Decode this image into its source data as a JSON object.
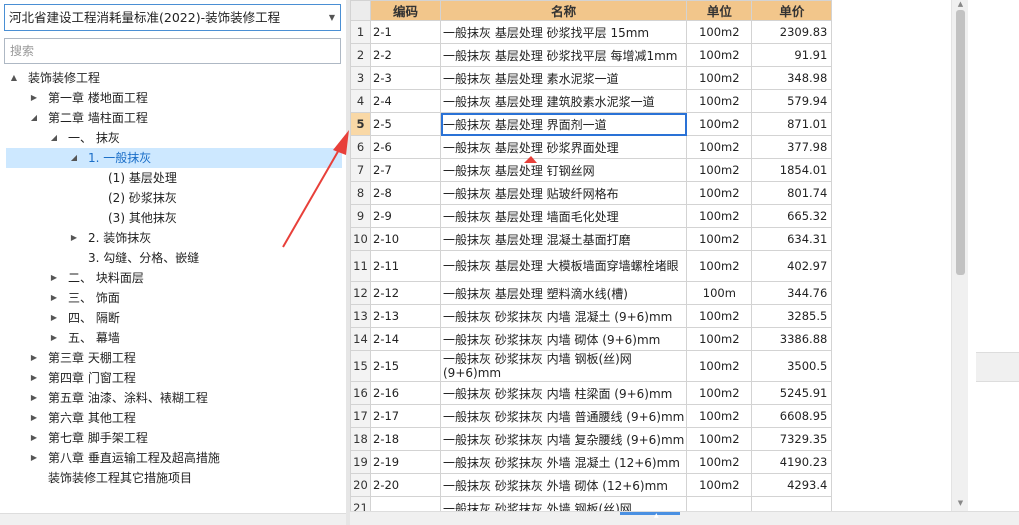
{
  "dropdown": {
    "value": "河北省建设工程消耗量标准(2022)-装饰装修工程",
    "icon": "chevron-down-icon"
  },
  "search": {
    "placeholder": "搜索"
  },
  "tree": [
    {
      "label": "装饰装修工程",
      "level": 0,
      "toggle": "▲"
    },
    {
      "label": "第一章 楼地面工程",
      "level": 1,
      "toggle": "▶"
    },
    {
      "label": "第二章 墙柱面工程",
      "level": 1,
      "toggle": "◢"
    },
    {
      "label": "一、 抹灰",
      "level": 2,
      "toggle": "◢"
    },
    {
      "label": "1. 一般抹灰",
      "level": 3,
      "toggle": "◢",
      "selected": true
    },
    {
      "label": "(1) 基层处理",
      "level": 4,
      "toggle": ""
    },
    {
      "label": "(2) 砂浆抹灰",
      "level": 4,
      "toggle": ""
    },
    {
      "label": "(3) 其他抹灰",
      "level": 4,
      "toggle": ""
    },
    {
      "label": "2. 装饰抹灰",
      "level": 3,
      "toggle": "▶"
    },
    {
      "label": "3. 勾缝、分格、嵌缝",
      "level": 3,
      "toggle": ""
    },
    {
      "label": "二、 块料面层",
      "level": 2,
      "toggle": "▶"
    },
    {
      "label": "三、 饰面",
      "level": 2,
      "toggle": "▶"
    },
    {
      "label": "四、 隔断",
      "level": 2,
      "toggle": "▶"
    },
    {
      "label": "五、 幕墙",
      "level": 2,
      "toggle": "▶"
    },
    {
      "label": "第三章 天棚工程",
      "level": 1,
      "toggle": "▶"
    },
    {
      "label": "第四章 门窗工程",
      "level": 1,
      "toggle": "▶"
    },
    {
      "label": "第五章 油漆、涂料、裱糊工程",
      "level": 1,
      "toggle": "▶"
    },
    {
      "label": "第六章 其他工程",
      "level": 1,
      "toggle": "▶"
    },
    {
      "label": "第七章 脚手架工程",
      "level": 1,
      "toggle": "▶"
    },
    {
      "label": "第八章 垂直运输工程及超高措施",
      "level": 1,
      "toggle": "▶"
    },
    {
      "label": "装饰装修工程其它措施项目",
      "level": 1,
      "toggle": ""
    }
  ],
  "table": {
    "headers": {
      "code": "编码",
      "name": "名称",
      "unit": "单位",
      "price": "单价"
    },
    "current_row": 5,
    "rows": [
      {
        "n": "1",
        "code": "2-1",
        "name": "一般抹灰 基层处理 砂浆找平层 15mm",
        "unit": "100m2",
        "price": "2309.83"
      },
      {
        "n": "2",
        "code": "2-2",
        "name": "一般抹灰 基层处理 砂浆找平层 每增减1mm",
        "unit": "100m2",
        "price": "91.91"
      },
      {
        "n": "3",
        "code": "2-3",
        "name": "一般抹灰 基层处理 素水泥浆一道",
        "unit": "100m2",
        "price": "348.98"
      },
      {
        "n": "4",
        "code": "2-4",
        "name": "一般抹灰 基层处理 建筑胶素水泥浆一道",
        "unit": "100m2",
        "price": "579.94"
      },
      {
        "n": "5",
        "code": "2-5",
        "name": "一般抹灰 基层处理 界面剂一道",
        "unit": "100m2",
        "price": "871.01"
      },
      {
        "n": "6",
        "code": "2-6",
        "name": "一般抹灰 基层处理 砂浆界面处理",
        "unit": "100m2",
        "price": "377.98"
      },
      {
        "n": "7",
        "code": "2-7",
        "name": "一般抹灰 基层处理 钉钢丝网",
        "unit": "100m2",
        "price": "1854.01"
      },
      {
        "n": "8",
        "code": "2-8",
        "name": "一般抹灰 基层处理 贴玻纤网格布",
        "unit": "100m2",
        "price": "801.74"
      },
      {
        "n": "9",
        "code": "2-9",
        "name": "一般抹灰 基层处理 墙面毛化处理",
        "unit": "100m2",
        "price": "665.32"
      },
      {
        "n": "10",
        "code": "2-10",
        "name": "一般抹灰 基层处理 混凝土基面打磨",
        "unit": "100m2",
        "price": "634.31"
      },
      {
        "n": "11",
        "code": "2-11",
        "name": "一般抹灰 基层处理 大模板墙面穿墙螺栓堵眼",
        "unit": "100m2",
        "price": "402.97",
        "tall": true
      },
      {
        "n": "12",
        "code": "2-12",
        "name": "一般抹灰 基层处理 塑料滴水线(槽)",
        "unit": "100m",
        "price": "344.76"
      },
      {
        "n": "13",
        "code": "2-13",
        "name": "一般抹灰 砂浆抹灰 内墙 混凝土 (9+6)mm",
        "unit": "100m2",
        "price": "3285.5"
      },
      {
        "n": "14",
        "code": "2-14",
        "name": "一般抹灰 砂浆抹灰 内墙 砌体 (9+6)mm",
        "unit": "100m2",
        "price": "3386.88"
      },
      {
        "n": "15",
        "code": "2-15",
        "name": "一般抹灰 砂浆抹灰 内墙 钢板(丝)网 (9+6)mm",
        "unit": "100m2",
        "price": "3500.5",
        "tall": true
      },
      {
        "n": "16",
        "code": "2-16",
        "name": "一般抹灰 砂浆抹灰 内墙 柱梁面 (9+6)mm",
        "unit": "100m2",
        "price": "5245.91"
      },
      {
        "n": "17",
        "code": "2-17",
        "name": "一般抹灰 砂浆抹灰 内墙 普通腰线 (9+6)mm",
        "unit": "100m2",
        "price": "6608.95"
      },
      {
        "n": "18",
        "code": "2-18",
        "name": "一般抹灰 砂浆抹灰 内墙 复杂腰线 (9+6)mm",
        "unit": "100m2",
        "price": "7329.35"
      },
      {
        "n": "19",
        "code": "2-19",
        "name": "一般抹灰 砂浆抹灰 外墙 混凝土 (12+6)mm",
        "unit": "100m2",
        "price": "4190.23"
      },
      {
        "n": "20",
        "code": "2-20",
        "name": "一般抹灰 砂浆抹灰 外墙 砌体 (12+6)mm",
        "unit": "100m2",
        "price": "4293.4"
      },
      {
        "n": "21",
        "code": "",
        "name": "一般抹灰 砂浆抹灰 外墙 钢板(丝)网",
        "unit": "",
        "price": ""
      }
    ]
  },
  "annotation": {
    "arrow_color": "#e8403a"
  }
}
